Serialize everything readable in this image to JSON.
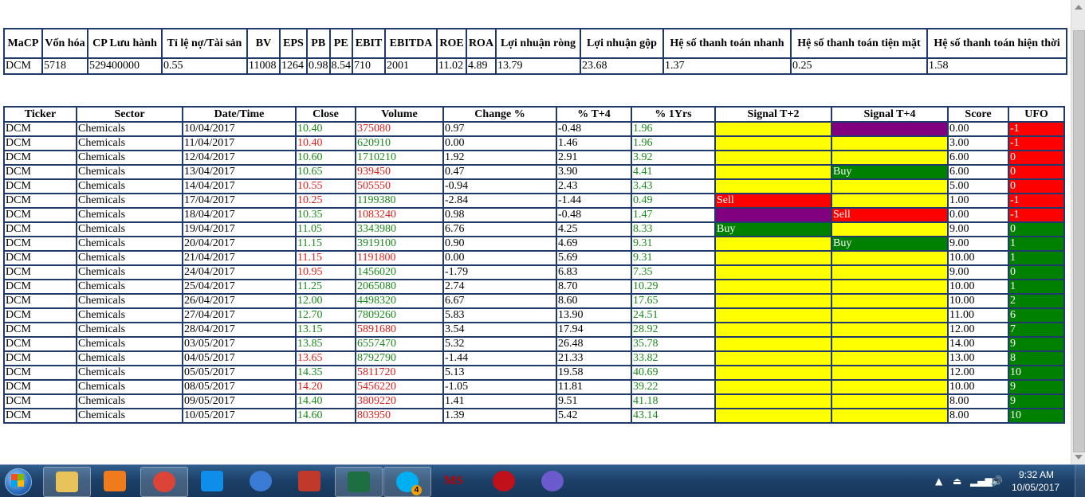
{
  "fundamentals": {
    "headers": [
      "MaCP",
      "Vốn hóa",
      "CP Lưu hành",
      "Tỉ lệ nợ/Tài sản",
      "BV",
      "EPS",
      "PB",
      "PE",
      "EBIT",
      "EBITDA",
      "ROE",
      "ROA",
      "Lợi nhuận ròng",
      "Lợi nhuận gộp",
      "Hệ số thanh toán nhanh",
      "Hệ số thanh toán tiện mặt",
      "Hệ số thanh toán hiện thời"
    ],
    "row": [
      "DCM",
      "5718",
      "529400000",
      "0.55",
      "11008",
      "1264",
      "0.98",
      "8.54",
      "710",
      "2001",
      "11.02",
      "4.89",
      "13.79",
      "23.68",
      "1.37",
      "0.25",
      "1.58"
    ]
  },
  "history": {
    "headers": [
      "Ticker",
      "Sector",
      "Date/Time",
      "Close",
      "Volume",
      "Change %",
      "% T+4",
      "% 1Yrs",
      "Signal T+2",
      "Signal T+4",
      "Score",
      "UFO"
    ],
    "rows": [
      {
        "ticker": "DCM",
        "sector": "Chemicals",
        "date": "10/04/2017",
        "close": "10.40",
        "close_color": "green",
        "volume": "375080",
        "volume_color": "red",
        "change": "0.97",
        "t4": "-0.48",
        "y1": "1.96",
        "y1_color": "green",
        "s2": "",
        "s2_color": "yellow",
        "s4": "",
        "s4_color": "purple",
        "score": "0.00",
        "ufo": "-1",
        "ufo_color": "red"
      },
      {
        "ticker": "DCM",
        "sector": "Chemicals",
        "date": "11/04/2017",
        "close": "10.40",
        "close_color": "red",
        "volume": "620910",
        "volume_color": "green",
        "change": "0.00",
        "t4": "1.46",
        "y1": "1.96",
        "y1_color": "green",
        "s2": "",
        "s2_color": "yellow",
        "s4": "",
        "s4_color": "yellow",
        "score": "3.00",
        "ufo": "-1",
        "ufo_color": "red"
      },
      {
        "ticker": "DCM",
        "sector": "Chemicals",
        "date": "12/04/2017",
        "close": "10.60",
        "close_color": "green",
        "volume": "1710210",
        "volume_color": "green",
        "change": "1.92",
        "t4": "2.91",
        "y1": "3.92",
        "y1_color": "green",
        "s2": "",
        "s2_color": "yellow",
        "s4": "",
        "s4_color": "yellow",
        "score": "6.00",
        "ufo": "0",
        "ufo_color": "red"
      },
      {
        "ticker": "DCM",
        "sector": "Chemicals",
        "date": "13/04/2017",
        "close": "10.65",
        "close_color": "green",
        "volume": "939450",
        "volume_color": "red",
        "change": "0.47",
        "t4": "3.90",
        "y1": "4.41",
        "y1_color": "green",
        "s2": "",
        "s2_color": "yellow",
        "s4": "Buy",
        "s4_color": "green",
        "score": "6.00",
        "ufo": "0",
        "ufo_color": "red"
      },
      {
        "ticker": "DCM",
        "sector": "Chemicals",
        "date": "14/04/2017",
        "close": "10.55",
        "close_color": "red",
        "volume": "505550",
        "volume_color": "red",
        "change": "-0.94",
        "t4": "2.43",
        "y1": "3.43",
        "y1_color": "green",
        "s2": "",
        "s2_color": "yellow",
        "s4": "",
        "s4_color": "yellow",
        "score": "5.00",
        "ufo": "0",
        "ufo_color": "red"
      },
      {
        "ticker": "DCM",
        "sector": "Chemicals",
        "date": "17/04/2017",
        "close": "10.25",
        "close_color": "red",
        "volume": "1199380",
        "volume_color": "green",
        "change": "-2.84",
        "t4": "-1.44",
        "y1": "0.49",
        "y1_color": "green",
        "s2": "Sell",
        "s2_color": "red",
        "s4": "",
        "s4_color": "yellow",
        "score": "1.00",
        "ufo": "-1",
        "ufo_color": "red"
      },
      {
        "ticker": "DCM",
        "sector": "Chemicals",
        "date": "18/04/2017",
        "close": "10.35",
        "close_color": "green",
        "volume": "1083240",
        "volume_color": "red",
        "change": "0.98",
        "t4": "-0.48",
        "y1": "1.47",
        "y1_color": "green",
        "s2": "",
        "s2_color": "purple",
        "s4": "Sell",
        "s4_color": "red",
        "score": "0.00",
        "ufo": "-1",
        "ufo_color": "red"
      },
      {
        "ticker": "DCM",
        "sector": "Chemicals",
        "date": "19/04/2017",
        "close": "11.05",
        "close_color": "green",
        "volume": "3343980",
        "volume_color": "green",
        "change": "6.76",
        "t4": "4.25",
        "y1": "8.33",
        "y1_color": "green",
        "s2": "Buy",
        "s2_color": "green",
        "s4": "",
        "s4_color": "yellow",
        "score": "9.00",
        "ufo": "0",
        "ufo_color": "green"
      },
      {
        "ticker": "DCM",
        "sector": "Chemicals",
        "date": "20/04/2017",
        "close": "11.15",
        "close_color": "green",
        "volume": "3919100",
        "volume_color": "green",
        "change": "0.90",
        "t4": "4.69",
        "y1": "9.31",
        "y1_color": "green",
        "s2": "",
        "s2_color": "yellow",
        "s4": "Buy",
        "s4_color": "green",
        "score": "9.00",
        "ufo": "1",
        "ufo_color": "green"
      },
      {
        "ticker": "DCM",
        "sector": "Chemicals",
        "date": "21/04/2017",
        "close": "11.15",
        "close_color": "red",
        "volume": "1191800",
        "volume_color": "red",
        "change": "0.00",
        "t4": "5.69",
        "y1": "9.31",
        "y1_color": "green",
        "s2": "",
        "s2_color": "yellow",
        "s4": "",
        "s4_color": "yellow",
        "score": "10.00",
        "ufo": "1",
        "ufo_color": "green"
      },
      {
        "ticker": "DCM",
        "sector": "Chemicals",
        "date": "24/04/2017",
        "close": "10.95",
        "close_color": "red",
        "volume": "1456020",
        "volume_color": "green",
        "change": "-1.79",
        "t4": "6.83",
        "y1": "7.35",
        "y1_color": "green",
        "s2": "",
        "s2_color": "yellow",
        "s4": "",
        "s4_color": "yellow",
        "score": "9.00",
        "ufo": "0",
        "ufo_color": "green"
      },
      {
        "ticker": "DCM",
        "sector": "Chemicals",
        "date": "25/04/2017",
        "close": "11.25",
        "close_color": "green",
        "volume": "2065080",
        "volume_color": "green",
        "change": "2.74",
        "t4": "8.70",
        "y1": "10.29",
        "y1_color": "green",
        "s2": "",
        "s2_color": "yellow",
        "s4": "",
        "s4_color": "yellow",
        "score": "10.00",
        "ufo": "1",
        "ufo_color": "green"
      },
      {
        "ticker": "DCM",
        "sector": "Chemicals",
        "date": "26/04/2017",
        "close": "12.00",
        "close_color": "green",
        "volume": "4498320",
        "volume_color": "green",
        "change": "6.67",
        "t4": "8.60",
        "y1": "17.65",
        "y1_color": "green",
        "s2": "",
        "s2_color": "yellow",
        "s4": "",
        "s4_color": "yellow",
        "score": "10.00",
        "ufo": "2",
        "ufo_color": "green"
      },
      {
        "ticker": "DCM",
        "sector": "Chemicals",
        "date": "27/04/2017",
        "close": "12.70",
        "close_color": "green",
        "volume": "7809260",
        "volume_color": "green",
        "change": "5.83",
        "t4": "13.90",
        "y1": "24.51",
        "y1_color": "green",
        "s2": "",
        "s2_color": "yellow",
        "s4": "",
        "s4_color": "yellow",
        "score": "11.00",
        "ufo": "6",
        "ufo_color": "green"
      },
      {
        "ticker": "DCM",
        "sector": "Chemicals",
        "date": "28/04/2017",
        "close": "13.15",
        "close_color": "green",
        "volume": "5891680",
        "volume_color": "red",
        "change": "3.54",
        "t4": "17.94",
        "y1": "28.92",
        "y1_color": "green",
        "s2": "",
        "s2_color": "yellow",
        "s4": "",
        "s4_color": "yellow",
        "score": "12.00",
        "ufo": "7",
        "ufo_color": "green"
      },
      {
        "ticker": "DCM",
        "sector": "Chemicals",
        "date": "03/05/2017",
        "close": "13.85",
        "close_color": "green",
        "volume": "6557470",
        "volume_color": "green",
        "change": "5.32",
        "t4": "26.48",
        "y1": "35.78",
        "y1_color": "green",
        "s2": "",
        "s2_color": "yellow",
        "s4": "",
        "s4_color": "yellow",
        "score": "14.00",
        "ufo": "9",
        "ufo_color": "green"
      },
      {
        "ticker": "DCM",
        "sector": "Chemicals",
        "date": "04/05/2017",
        "close": "13.65",
        "close_color": "red",
        "volume": "8792790",
        "volume_color": "green",
        "change": "-1.44",
        "t4": "21.33",
        "y1": "33.82",
        "y1_color": "green",
        "s2": "",
        "s2_color": "yellow",
        "s4": "",
        "s4_color": "yellow",
        "score": "13.00",
        "ufo": "8",
        "ufo_color": "green"
      },
      {
        "ticker": "DCM",
        "sector": "Chemicals",
        "date": "05/05/2017",
        "close": "14.35",
        "close_color": "green",
        "volume": "5811720",
        "volume_color": "red",
        "change": "5.13",
        "t4": "19.58",
        "y1": "40.69",
        "y1_color": "green",
        "s2": "",
        "s2_color": "yellow",
        "s4": "",
        "s4_color": "yellow",
        "score": "12.00",
        "ufo": "10",
        "ufo_color": "green"
      },
      {
        "ticker": "DCM",
        "sector": "Chemicals",
        "date": "08/05/2017",
        "close": "14.20",
        "close_color": "red",
        "volume": "5456220",
        "volume_color": "red",
        "change": "-1.05",
        "t4": "11.81",
        "y1": "39.22",
        "y1_color": "green",
        "s2": "",
        "s2_color": "yellow",
        "s4": "",
        "s4_color": "yellow",
        "score": "10.00",
        "ufo": "9",
        "ufo_color": "green"
      },
      {
        "ticker": "DCM",
        "sector": "Chemicals",
        "date": "09/05/2017",
        "close": "14.40",
        "close_color": "green",
        "volume": "3809220",
        "volume_color": "red",
        "change": "1.41",
        "t4": "9.51",
        "y1": "41.18",
        "y1_color": "green",
        "s2": "",
        "s2_color": "yellow",
        "s4": "",
        "s4_color": "yellow",
        "score": "8.00",
        "ufo": "9",
        "ufo_color": "green"
      },
      {
        "ticker": "DCM",
        "sector": "Chemicals",
        "date": "10/05/2017",
        "close": "14.60",
        "close_color": "green",
        "volume": "803950",
        "volume_color": "red",
        "change": "1.39",
        "t4": "5.42",
        "y1": "43.14",
        "y1_color": "green",
        "s2": "",
        "s2_color": "yellow",
        "s4": "",
        "s4_color": "yellow",
        "score": "8.00",
        "ufo": "10",
        "ufo_color": "green"
      }
    ]
  },
  "taskbar": {
    "apps": [
      {
        "name": "file-explorer-icon",
        "color": "#e8c35a",
        "active": true
      },
      {
        "name": "media-player-icon",
        "color": "#f07b1c",
        "active": false
      },
      {
        "name": "chrome-icon",
        "color": "#db4437",
        "active": true
      },
      {
        "name": "teamviewer-icon",
        "color": "#0e8ee9",
        "active": false
      },
      {
        "name": "browser-icon",
        "color": "#3a7bd5",
        "active": false
      },
      {
        "name": "java-icon",
        "color": "#c0392b",
        "active": false
      },
      {
        "name": "excel-icon",
        "color": "#1d6f42",
        "active": true
      },
      {
        "name": "skype-icon",
        "color": "#00aff0",
        "active": true
      },
      {
        "name": "ms-trading-icon",
        "color": "#c00000",
        "active": false
      },
      {
        "name": "stock-app-icon",
        "color": "#c0101a",
        "active": false
      },
      {
        "name": "sync-app-icon",
        "color": "#6a5acd",
        "active": false
      }
    ],
    "skype_badge": "4",
    "ms_label": "MS",
    "time": "9:32 AM",
    "date": "10/05/2017"
  }
}
